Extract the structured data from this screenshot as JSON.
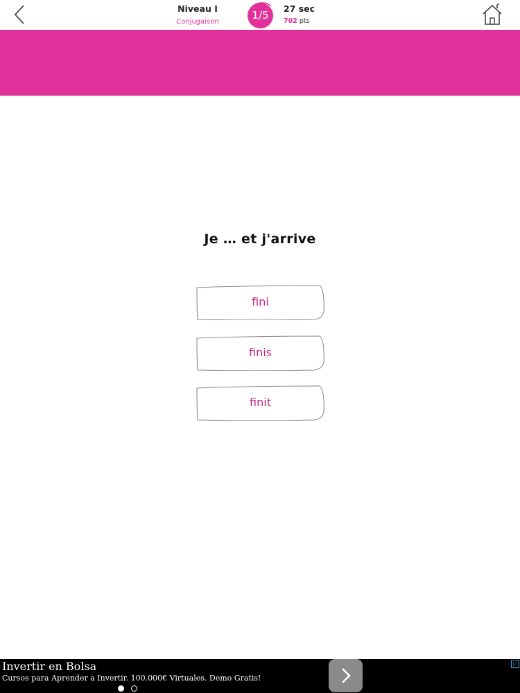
{
  "header": {
    "level_title": "Niveau I",
    "level_subtitle": "Conjugaison",
    "progress": "1/5",
    "timer": "27 sec",
    "points_value": "702",
    "points_unit": "pts",
    "icons": {
      "back": "chevron-left-icon",
      "home": "home-icon"
    },
    "accent_color": "#e0319b"
  },
  "question": {
    "text": "Je … et j'arrive"
  },
  "answers": [
    {
      "label": "fini"
    },
    {
      "label": "finis"
    },
    {
      "label": "finit"
    }
  ],
  "ad": {
    "title": "Invertir en Bolsa",
    "description": "Cursos para Aprender a Invertir. 100.000€ Virtuales. Demo Gratis!",
    "cta_icon": "chevron-right-icon",
    "info_icon": "ad-choices-icon",
    "page_dots": {
      "count": 2,
      "active": 1
    }
  }
}
